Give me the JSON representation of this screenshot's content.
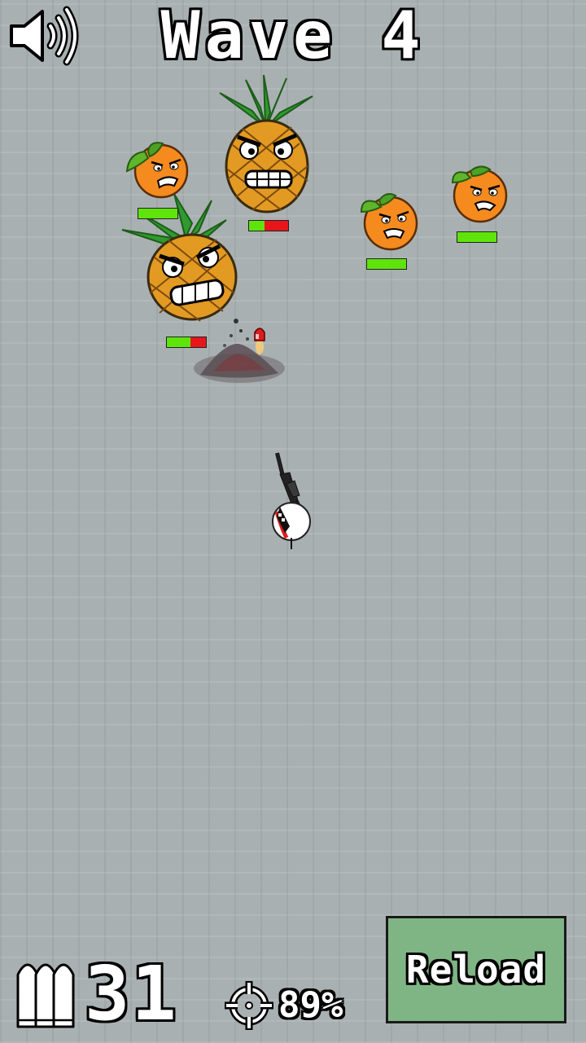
{
  "hud": {
    "wave_label": "Wave 4",
    "ammo_count": "31",
    "accuracy": "89%",
    "reload_label": "Reload"
  },
  "icons": {
    "sound": "speaker-volume-icon",
    "ammo": "bullets-icon",
    "accuracy": "crosshair-icon"
  },
  "colors": {
    "background": "#a9b0b2",
    "reload_button": "#7fb584",
    "health_full": "#5ee40b",
    "health_missing": "#e8161b"
  },
  "enemies": [
    {
      "type": "orange",
      "health_fraction": 1.0
    },
    {
      "type": "pineapple",
      "health_fraction": 0.4
    },
    {
      "type": "pineapple",
      "health_fraction": 0.6
    },
    {
      "type": "orange",
      "health_fraction": 1.0
    },
    {
      "type": "orange",
      "health_fraction": 1.0
    }
  ]
}
